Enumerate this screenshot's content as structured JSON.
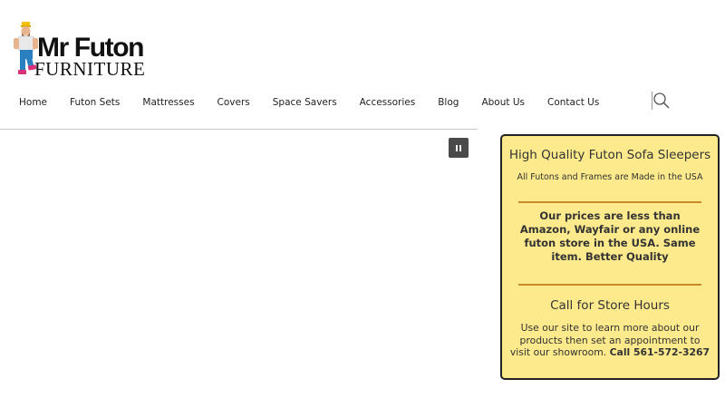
{
  "logo": {
    "title": "Mr Futon",
    "subtitle": "FURNITURE",
    "figure_icon": "mascot-figure"
  },
  "nav": {
    "items": [
      {
        "label": "Home"
      },
      {
        "label": "Futon Sets"
      },
      {
        "label": "Mattresses"
      },
      {
        "label": "Covers"
      },
      {
        "label": "Space Savers"
      },
      {
        "label": "Accessories"
      },
      {
        "label": "Blog"
      },
      {
        "label": "About Us"
      },
      {
        "label": "Contact Us"
      }
    ],
    "search_icon": "search-icon"
  },
  "slider": {
    "pause_icon": "pause-icon"
  },
  "info_box": {
    "heading": "High Quality Futon Sofa Sleepers",
    "subheading": "All Futons and Frames are Made in the USA",
    "promo": "Our prices are less than Amazon, Wayfair or any online futon store in the USA. Same item. Better Quality",
    "hours_heading": "Call for Store Hours",
    "body_text": "Use our site to learn more about our products then set an appointment to visit our showroom. ",
    "phone": "Call 561-572-3267",
    "colors": {
      "background": "#fdea8c",
      "rule": "#c98a2a",
      "border": "#222222"
    }
  }
}
